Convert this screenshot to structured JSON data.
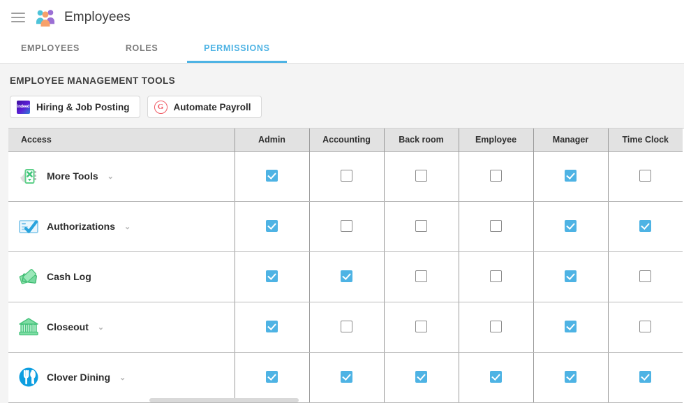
{
  "header": {
    "menu_icon": "hamburger-icon",
    "app_icon": "employees-group-icon",
    "title": "Employees"
  },
  "tabs": [
    {
      "label": "EMPLOYEES",
      "active": false
    },
    {
      "label": "ROLES",
      "active": false
    },
    {
      "label": "PERMISSIONS",
      "active": true
    }
  ],
  "section": {
    "title": "EMPLOYEE MANAGEMENT TOOLS",
    "buttons": [
      {
        "label": "Hiring & Job Posting",
        "icon": "indeed-logo-icon",
        "icon_text": "indeed"
      },
      {
        "label": "Automate Payroll",
        "icon": "gusto-logo-icon",
        "icon_text": "G"
      }
    ]
  },
  "table": {
    "columns": [
      "Access",
      "Admin",
      "Accounting",
      "Back room",
      "Employee",
      "Manager",
      "Time Clock"
    ],
    "rows": [
      {
        "label": "More Tools",
        "icon": "more-tools-icon",
        "has_chevron": true,
        "permissions": [
          true,
          false,
          false,
          false,
          true,
          false
        ]
      },
      {
        "label": "Authorizations",
        "icon": "authorizations-card-check-icon",
        "has_chevron": true,
        "permissions": [
          true,
          false,
          false,
          false,
          true,
          true
        ]
      },
      {
        "label": "Cash Log",
        "icon": "cash-log-money-icon",
        "has_chevron": false,
        "permissions": [
          true,
          true,
          false,
          false,
          true,
          false
        ]
      },
      {
        "label": "Closeout",
        "icon": "closeout-bank-icon",
        "has_chevron": true,
        "permissions": [
          true,
          false,
          false,
          false,
          true,
          false
        ]
      },
      {
        "label": "Clover Dining",
        "icon": "clover-dining-icon",
        "has_chevron": true,
        "permissions": [
          true,
          true,
          true,
          true,
          true,
          true
        ]
      }
    ]
  },
  "colors": {
    "accent": "#4eb3e4",
    "tab_inactive": "#7b7b7b",
    "header_bg": "#e2e2e2",
    "content_bg": "#f4f4f4",
    "indeed_purple": "#5b1fd6",
    "gusto_red": "#f05a64"
  },
  "chevron_glyph": "⌄"
}
